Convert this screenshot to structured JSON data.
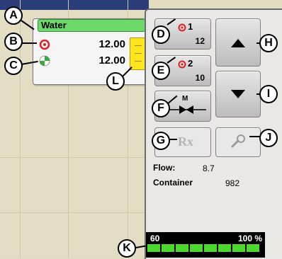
{
  "product": {
    "name": "Water",
    "rate_target": "12.00",
    "rate_actual": "12.00"
  },
  "sections": [
    {
      "label": "1",
      "value": "12"
    },
    {
      "label": "2",
      "value": "10"
    }
  ],
  "manual_button": {
    "label": "M"
  },
  "prescription_button": {
    "label": "Rx"
  },
  "info": {
    "flow_label": "Flow:",
    "flow_value": "8.7",
    "container_label": "Container",
    "container_value": "982"
  },
  "meter": {
    "left_label": "60",
    "right_label": "100 %",
    "segments": 8
  },
  "callouts": [
    "A",
    "B",
    "C",
    "D",
    "E",
    "F",
    "G",
    "H",
    "I",
    "J",
    "K",
    "L"
  ],
  "colors": {
    "title_green": "#6dd96a",
    "target_red": "#e02020",
    "meter_green": "#4dd82f",
    "indicator_yellow": "#ffe51e"
  }
}
